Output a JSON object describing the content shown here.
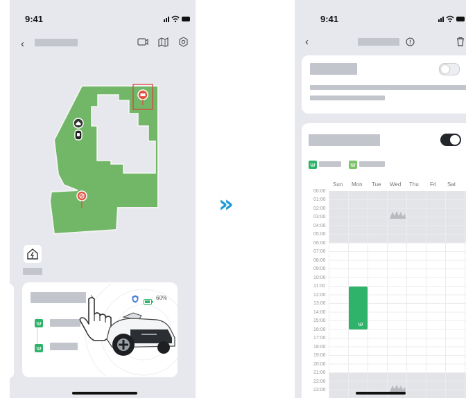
{
  "left_screen": {
    "status_time": "9:41",
    "signal": "••••",
    "battery_percent": "60%"
  },
  "right_screen": {
    "status_time": "9:41",
    "days": [
      "Sun",
      "Mon",
      "Tue",
      "Wed",
      "Thu",
      "Fri",
      "Sat"
    ],
    "hours": [
      "00:00",
      "01:00",
      "02:00",
      "03:00",
      "04:00",
      "05:00",
      "06:00",
      "07:00",
      "08:00",
      "09:00",
      "10:00",
      "11:00",
      "12:00",
      "13:00",
      "14:00",
      "15:00",
      "16:00",
      "17:00",
      "18:00",
      "19:00",
      "20:00",
      "21:00",
      "22:00",
      "23:00"
    ]
  },
  "transition_arrow": "»",
  "colors": {
    "lawn": "#71b767",
    "schedule_block": "#2fb26a",
    "accent_blue": "#1c9ad6",
    "no_go_red": "#e2533f"
  }
}
